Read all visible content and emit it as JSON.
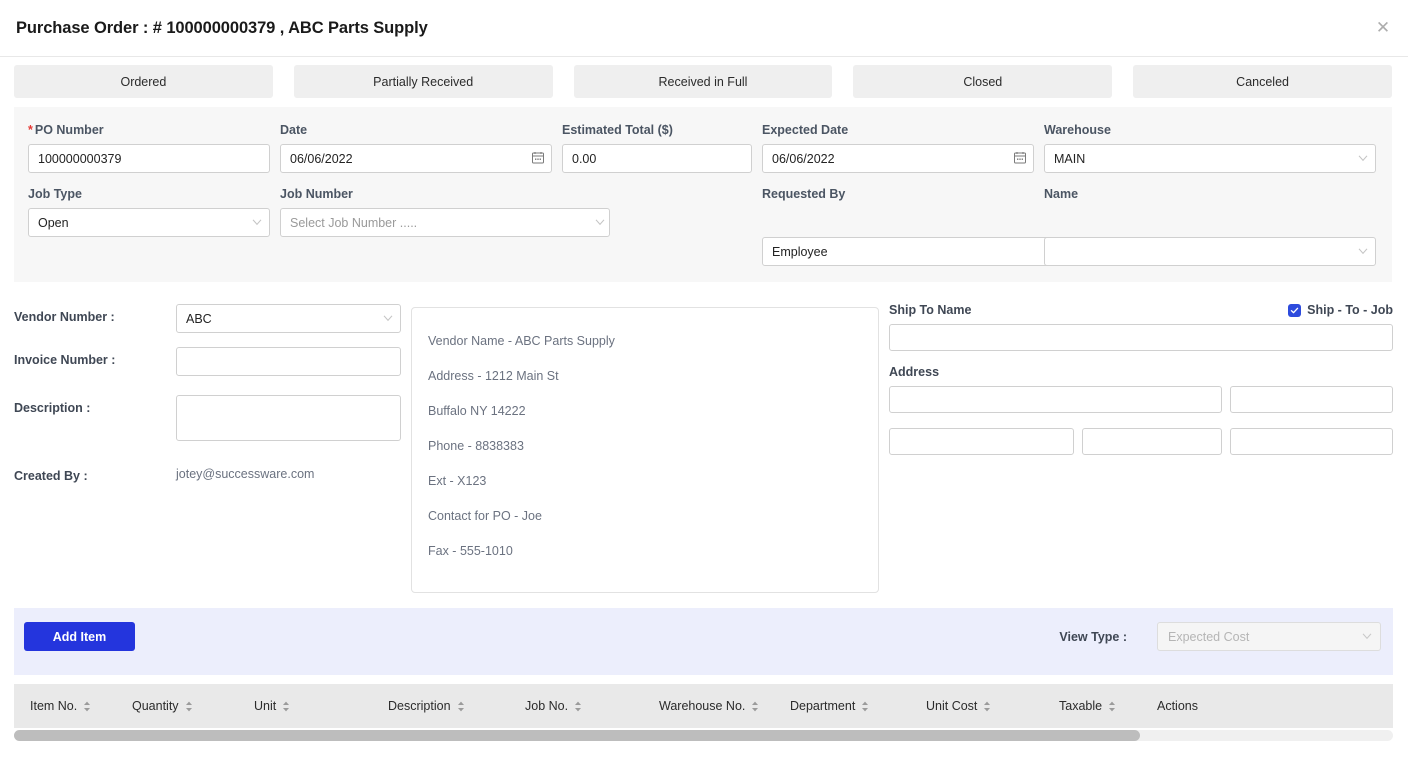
{
  "header": {
    "title": "Purchase Order : # 100000000379 , ABC Parts Supply",
    "close_icon": "close-icon",
    "close_glyph": "✕"
  },
  "status_tabs": [
    {
      "label": "Ordered"
    },
    {
      "label": "Partially Received"
    },
    {
      "label": "Received in Full"
    },
    {
      "label": "Closed"
    },
    {
      "label": "Canceled"
    }
  ],
  "form": {
    "po_number": {
      "label": "PO Number",
      "required_mark": "*",
      "value": "100000000379"
    },
    "date": {
      "label": "Date",
      "value": "06/06/2022",
      "icon": "calendar-icon",
      "icon_glyph": "📅"
    },
    "estimated_total": {
      "label": "Estimated Total ($)",
      "value": "0.00"
    },
    "expected_date": {
      "label": "Expected Date",
      "value": "06/06/2022",
      "icon": "calendar-icon",
      "icon_glyph": "📅"
    },
    "warehouse": {
      "label": "Warehouse",
      "value": "MAIN"
    },
    "job_type": {
      "label": "Job Type",
      "value": "Open"
    },
    "job_number": {
      "label": "Job Number",
      "placeholder": "Select Job Number .....",
      "value": ""
    },
    "requested_by": {
      "label": "Requested By",
      "value": "Employee"
    },
    "name": {
      "label": "Name",
      "value": ""
    }
  },
  "vendor_section": {
    "vendor_number": {
      "label": "Vendor Number :",
      "value": "ABC"
    },
    "invoice_number": {
      "label": "Invoice Number :",
      "value": ""
    },
    "description": {
      "label": "Description :",
      "value": ""
    },
    "created_by": {
      "label": "Created By :",
      "value": "jotey@successware.com"
    }
  },
  "vendor_card": {
    "lines": [
      "Vendor Name - ABC Parts Supply",
      "Address - 1212 Main St",
      "Buffalo NY 14222",
      "Phone - 8838383",
      "Ext - X123",
      "Contact for PO - Joe",
      "Fax - 555-1010"
    ]
  },
  "ship_to": {
    "name_label": "Ship To Name",
    "name_value": "",
    "checkbox_label": "Ship - To - Job",
    "checkbox_checked": true,
    "address_label": "Address",
    "address_line1": "",
    "address_line2": "",
    "address_city": "",
    "address_state": "",
    "address_zip": ""
  },
  "items_toolbar": {
    "add_item_label": "Add Item",
    "view_type_label": "View Type :",
    "view_type_value": "Expected Cost",
    "view_type_disabled": true
  },
  "table": {
    "columns": [
      {
        "label": "Item No.",
        "sortable": true
      },
      {
        "label": "Quantity",
        "sortable": true
      },
      {
        "label": "Unit",
        "sortable": true
      },
      {
        "label": "Description",
        "sortable": true
      },
      {
        "label": "Job No.",
        "sortable": true
      },
      {
        "label": "Warehouse No.",
        "sortable": true
      },
      {
        "label": "Department",
        "sortable": true
      },
      {
        "label": "Unit Cost",
        "sortable": true
      },
      {
        "label": "Taxable",
        "sortable": true
      },
      {
        "label": "Actions",
        "sortable": false
      }
    ],
    "rows": []
  },
  "colors": {
    "primary": "#2435dd",
    "checkbox": "#2d4bdd",
    "toolbar_bg": "#eceefc",
    "panel_bg": "#f7f7f7",
    "tab_bg": "#efefef",
    "table_header_bg": "#e9e9e9",
    "required": "#e53935"
  }
}
